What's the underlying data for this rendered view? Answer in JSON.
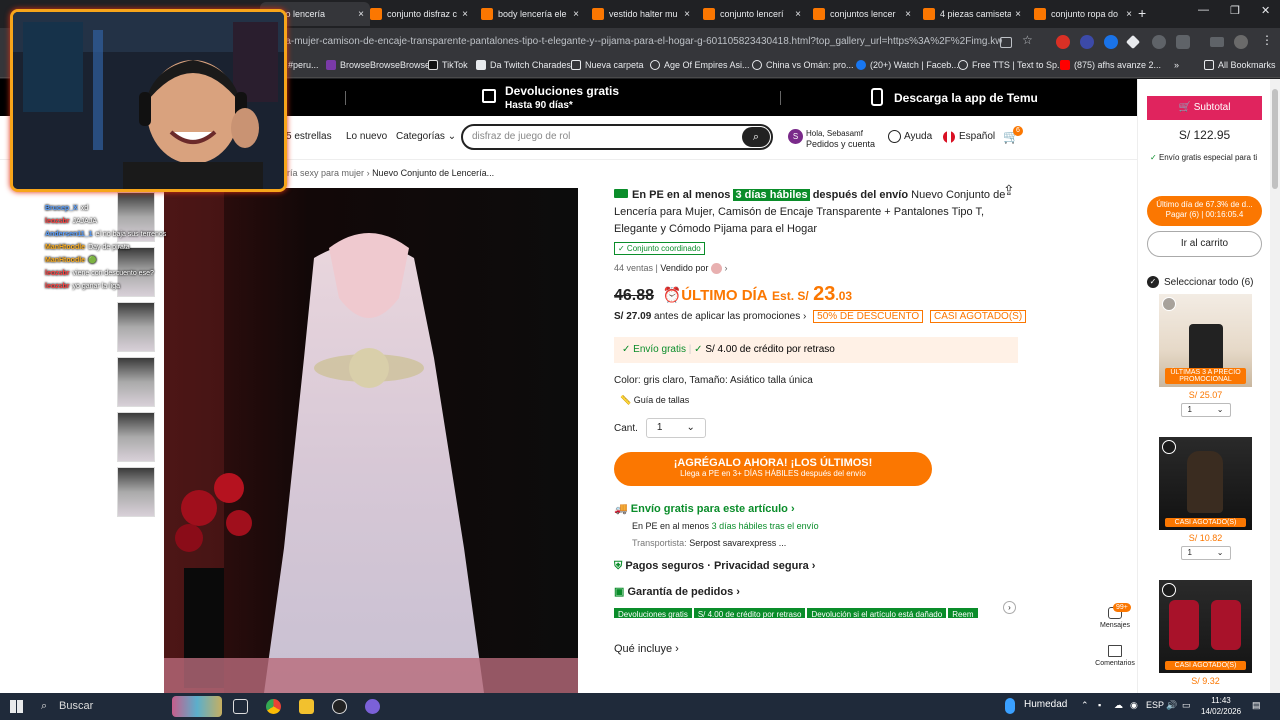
{
  "browser": {
    "tabs": [
      {
        "label": "njunto lencería",
        "active": true
      },
      {
        "label": "conjunto disfraz c"
      },
      {
        "label": "body lencería ele"
      },
      {
        "label": "vestido halter mu"
      },
      {
        "label": "conjunto lencerí"
      },
      {
        "label": "conjuntos lencer"
      },
      {
        "label": "4 piezas camiseta"
      },
      {
        "label": "conjunto ropa do"
      }
    ],
    "tab_close": "×",
    "new_tab": "+",
    "url": "ra-mujer-camison-de-encaje-transparente-pantalones-tipo-t-elegante-y--pijama-para-el-hogar-g-601105823430418.html?top_gallery_url=https%3A%2F%2Fimg.kwcdn...",
    "bookmarks": [
      {
        "label": "#peru...",
        "color": "#5f6368"
      },
      {
        "label": "BrowseBrowseBrowse",
        "color": "#7a3aa8"
      },
      {
        "label": "TikTok",
        "color": "#111111"
      },
      {
        "label": "Da Twitch Charades",
        "color": "#444444"
      },
      {
        "label": "Nueva carpeta",
        "color": "#888888"
      },
      {
        "label": "Age Of Empires Asi...",
        "color": "#888888"
      },
      {
        "label": "China vs Omán: pro...",
        "color": "#888888"
      },
      {
        "label": "(20+) Watch | Faceb...",
        "color": "#1877f2"
      },
      {
        "label": "Free TTS | Text to Sp...",
        "color": "#888888"
      },
      {
        "label": "(875) afhs avanze 2...",
        "color": "#ff0000"
      }
    ],
    "more_bookmarks": "»",
    "all_bookmarks": "All Bookmarks"
  },
  "banner": {
    "returns_title": "Devoluciones gratis",
    "returns_sub": "Hasta 90 días*",
    "download": "Descarga la app de Temu"
  },
  "nav": {
    "stars": "5 estrellas",
    "new": "Lo nuevo",
    "categories": "Categorías",
    "search_placeholder": "disfraz de juego de rol",
    "greeting": "Hola, Sebasamf",
    "account": "Pedidos y cuenta",
    "help": "Ayuda",
    "language": "Español",
    "cart_count": "6"
  },
  "breadcrumb": {
    "parent": "ería sexy para mujer",
    "current": "Nuevo Conjunto de Lencería..."
  },
  "product": {
    "ship_prefix": "En PE en al menos",
    "ship_days": "3 días hábiles",
    "ship_suffix": "después del envío",
    "title": "Nuevo Conjunto de Lencería para Mujer, Camisón de Encaje Transparente + Pantalones Tipo T, Elegante y Cómodo Pijama para el Hogar",
    "coord_badge": "✓ Conjunto coordinado",
    "sales": "44 ventas",
    "sold_by": "Vendido por",
    "old_price": "46.88",
    "last_day": "ÚLTIMO DÍA",
    "est_label": "Est. S/",
    "price_main": "23",
    "price_cents": ".03",
    "pre_promo_price": "S/ 27.09",
    "pre_promo_label": "antes de aplicar las promociones",
    "discount_tag": "50% DE DESCUENTO",
    "soldout_tag": "CASI AGOTADO(S)",
    "free_ship": "Envío gratis",
    "credit": "S/ 4.00 de crédito por retraso",
    "color_size": "Color: gris claro, Tamaño: Asiático talla única",
    "size_guide": "Guía de tallas",
    "qty_label": "Cant.",
    "qty_value": "1",
    "cta_main": "¡AGRÉGALO AHORA! ¡LOS ÚLTIMOS!",
    "cta_sub": "Llega a PE en 3+ DÍAS HÁBILES después del envío",
    "free_ship_article": "Envío gratis para este artículo",
    "ship_detail_prefix": "En PE en al menos",
    "ship_detail_days": "3 días hábiles tras el envío",
    "carrier_label": "Transportista:",
    "carrier_1": "Serpost",
    "carrier_2": "savarexpress ...",
    "secure": "Pagos seguros · Privacidad segura",
    "guarantee": "Garantía de pedidos",
    "chips": [
      "Devoluciones gratis",
      "S/ 4.00 de crédito por retraso",
      "Devolución si el artículo está dañado",
      "Reem"
    ],
    "includes": "Qué incluye"
  },
  "sidebar": {
    "subtotal_label": "Subtotal",
    "subtotal_value": "S/ 122.95",
    "free_ship_special": "Envío gratis especial para ti",
    "last_discount": "Último día de 67.3% de d...",
    "pay_timer": "Pagar (6) | 00:16:05.4",
    "go_to_cart": "Ir al carrito",
    "select_all": "Seleccionar todo (6)",
    "items": [
      {
        "label": "ÚLTIMAS 3 A PRECIO PROMOCIONAL",
        "price": "S/ 25.07",
        "qty": "1"
      },
      {
        "label": "CASI AGOTADO(S)",
        "price": "S/ 10.82",
        "qty": "1"
      },
      {
        "label": "CASI AGOTADO(S)",
        "price": "S/ 9.32",
        "qty": ""
      }
    ],
    "messages": "Mensajes",
    "messages_badge": "99+",
    "comments": "Comentarios"
  },
  "chat": [
    {
      "user": "Brucep_X",
      "color": "#5aa0ff",
      "msg": "xd"
    },
    {
      "user": "leozsbr",
      "color": "#ff4040",
      "msg": "JAJAJA"
    },
    {
      "user": "Andersen11_1",
      "color": "#5aa0ff",
      "msg": "el no baja sus terrenos"
    },
    {
      "user": "ManHtoodle",
      "color": "#ffb020",
      "msg": "Day de pirata"
    },
    {
      "user": "ManHtoodle",
      "color": "#ffb020",
      "msg": "🟢"
    },
    {
      "user": "leozsbr",
      "color": "#ff4040",
      "msg": "viene con descuento ese?"
    },
    {
      "user": "leozsbr",
      "color": "#ff4040",
      "msg": "yo ganar la liga"
    }
  ],
  "taskbar": {
    "search": "Buscar",
    "weather": "Humedad",
    "lang": "ESP",
    "time": "11:43",
    "date": "14/02/2026"
  }
}
